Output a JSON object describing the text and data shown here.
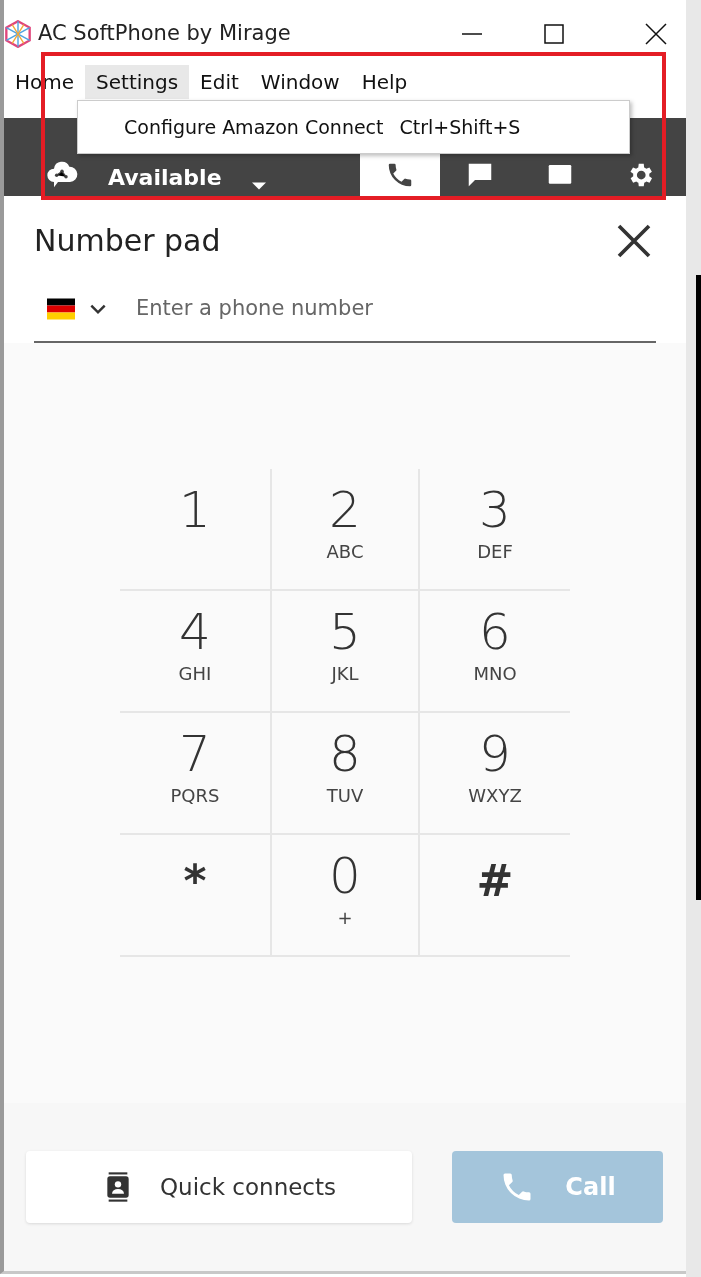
{
  "window": {
    "title": "AC SoftPhone by Mirage"
  },
  "menu": [
    {
      "label": "Home",
      "selected": false
    },
    {
      "label": "Settings",
      "selected": true
    },
    {
      "label": "Edit",
      "selected": false
    },
    {
      "label": "Window",
      "selected": false
    },
    {
      "label": "Help",
      "selected": false
    }
  ],
  "dropdown": [
    {
      "label": "Configure Amazon Connect",
      "shortcut": "Ctrl+Shift+S"
    }
  ],
  "toolbar": {
    "status": "Available",
    "tabs": [
      {
        "kind": "phone",
        "selected": true
      },
      {
        "kind": "chat",
        "selected": false
      },
      {
        "kind": "task",
        "selected": false
      },
      {
        "kind": "settings",
        "selected": false
      }
    ]
  },
  "number_pad": {
    "title": "Number pad",
    "phone_field": {
      "placeholder": "Enter a phone number"
    },
    "keys": [
      {
        "digit": "1"
      },
      {
        "digit": "2",
        "letters": "ABC"
      },
      {
        "digit": "3",
        "letters": "DEF"
      },
      {
        "digit": "4",
        "letters": "GHI"
      },
      {
        "digit": "5",
        "letters": "JKL"
      },
      {
        "digit": "6",
        "letters": "MNO"
      },
      {
        "digit": "7",
        "letters": "PQRS"
      },
      {
        "digit": "8",
        "letters": "TUV"
      },
      {
        "digit": "9",
        "letters": "WXYZ"
      },
      {
        "digit": "*"
      },
      {
        "digit": "0",
        "letters": "+"
      },
      {
        "digit": "#"
      }
    ]
  },
  "footer": {
    "quick_connects": "Quick connects",
    "call": {
      "label": "Call",
      "disabled": true
    }
  }
}
